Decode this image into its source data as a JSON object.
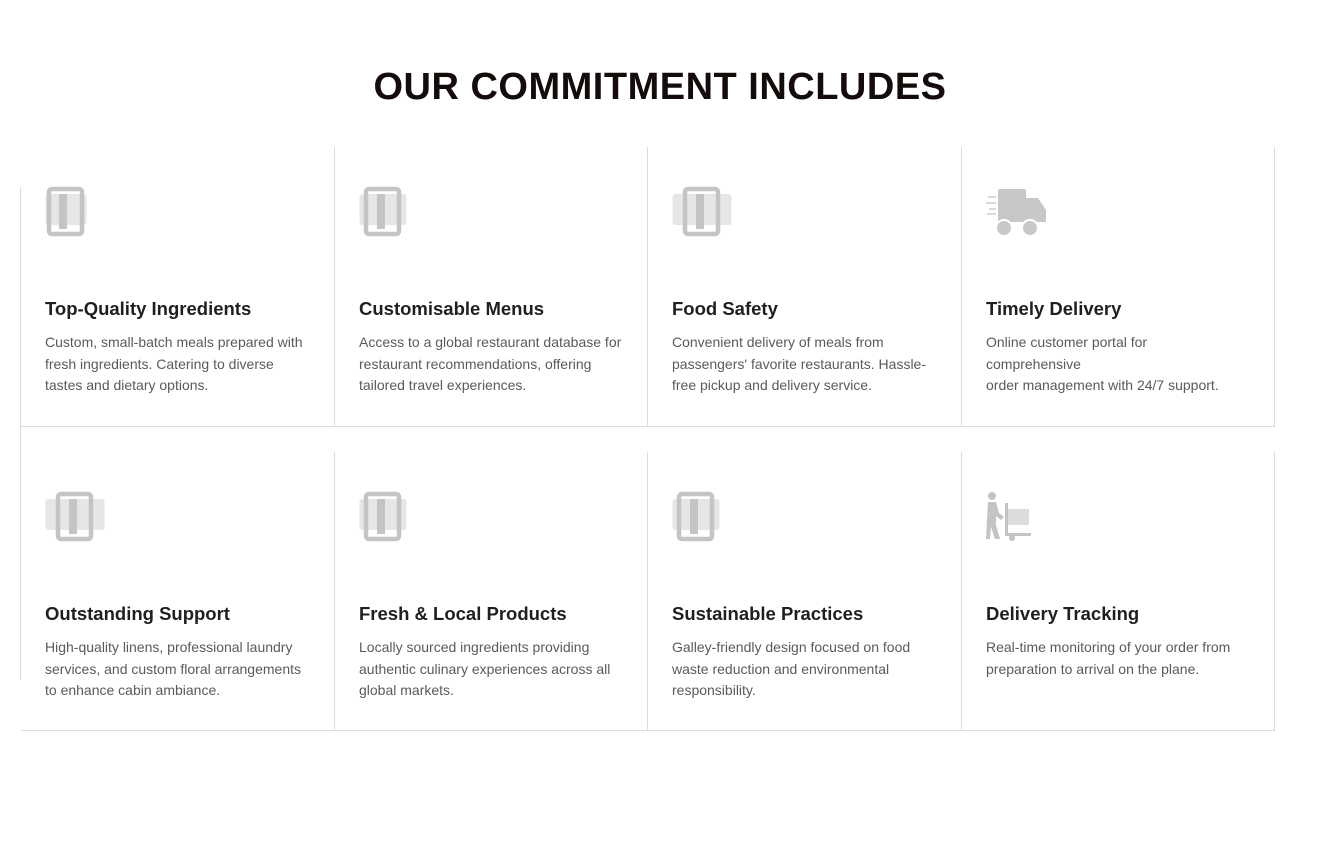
{
  "section": {
    "title": "OUR COMMITMENT INCLUDES"
  },
  "colors": {
    "title": "#140b0b",
    "card_heading": "#1f1f1f",
    "card_text": "#5a5a5a",
    "icon": "#c4c4c4",
    "grid_line": "#dcdcdc"
  },
  "cards": [
    {
      "title": "Top-Quality Ingredients",
      "icon": "panel-icon",
      "description": "Custom, small-batch meals prepared with fresh ingredients. Catering to diverse tastes and dietary options."
    },
    {
      "title": "Customisable Menus",
      "icon": "panel-icon",
      "description": "Access to a global restaurant database for restaurant recommendations, offering tailored travel experiences."
    },
    {
      "title": "Food Safety",
      "icon": "panel-icon",
      "description": "Convenient delivery of meals from passengers' favorite restaurants. Hassle-free pickup and delivery service."
    },
    {
      "title": "Timely Delivery",
      "icon": "delivery-truck-icon",
      "description_lines": [
        "Online customer portal for comprehensive",
        "order management with 24/7 support."
      ]
    },
    {
      "title": "Outstanding Support",
      "icon": "panel-icon",
      "description": "High-quality linens, professional laundry services, and custom floral arrangements to enhance cabin ambiance."
    },
    {
      "title": "Fresh & Local Products",
      "icon": "panel-icon",
      "description": "Locally sourced ingredients providing authentic culinary experiences across all global markets."
    },
    {
      "title": "Sustainable Practices",
      "icon": "panel-icon",
      "description": "Galley-friendly design focused on food waste reduction and environmental responsibility."
    },
    {
      "title": "Delivery Tracking",
      "icon": "hand-truck-icon",
      "description": "Real-time monitoring of your order from preparation to arrival on the plane."
    }
  ]
}
